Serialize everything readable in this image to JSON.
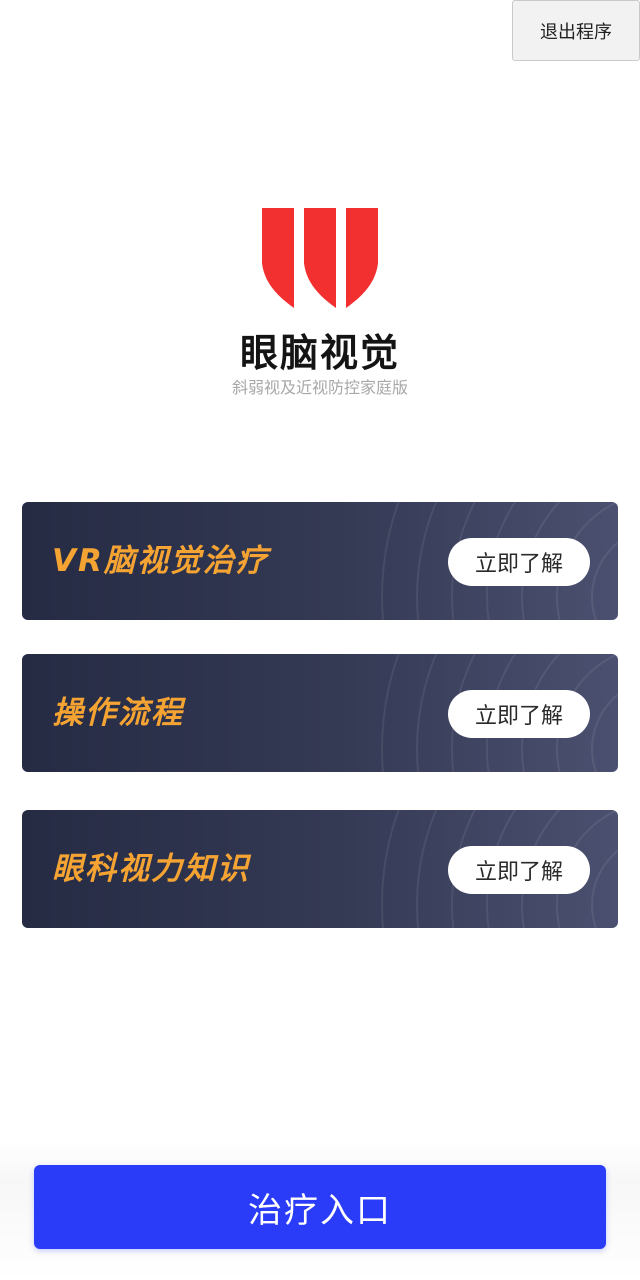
{
  "header": {
    "exit_label": "退出程序"
  },
  "logo": {
    "name": "眼脑视觉",
    "subtitle": "斜弱视及近视防控家庭版",
    "icon": "three-red-bars-logo",
    "color": "#f23030"
  },
  "cards": [
    {
      "title": "VR脑视觉治疗",
      "button_label": "立即了解"
    },
    {
      "title": "操作流程",
      "button_label": "立即了解"
    },
    {
      "title": "眼科视力知识",
      "button_label": "立即了解"
    }
  ],
  "footer": {
    "treatment_label": "治疗入口"
  },
  "colors": {
    "card_title": "#f5a433",
    "card_background": "#2d3250",
    "primary_button": "#2a3cf7"
  }
}
